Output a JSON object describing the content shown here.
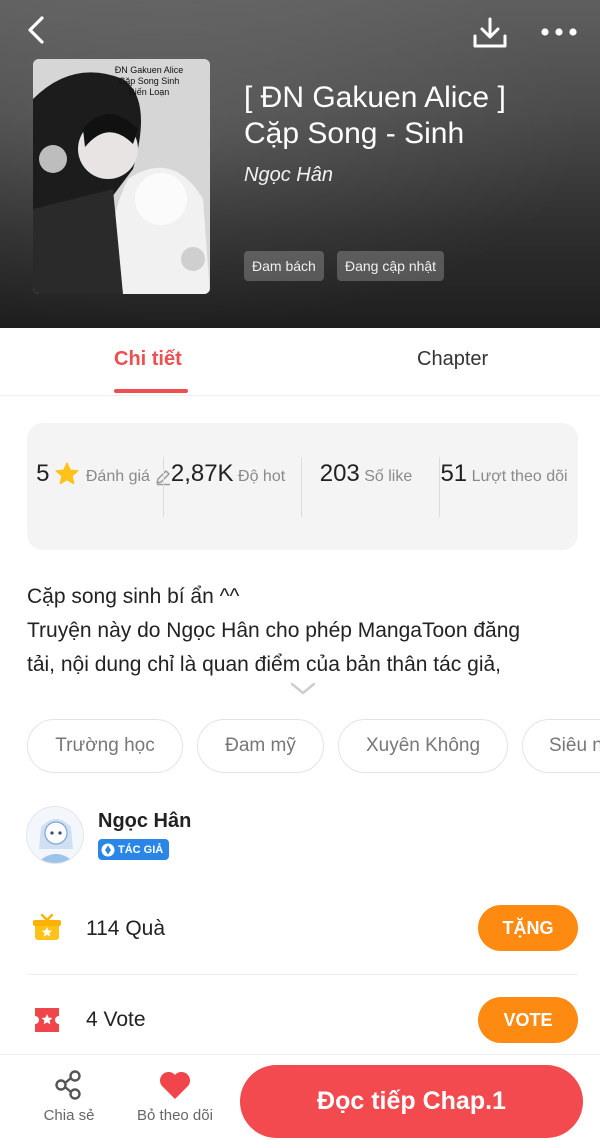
{
  "header": {
    "back_icon": "chevron-left-icon",
    "download_icon": "download-icon",
    "more_icon": "more-horizontal-icon",
    "cover": {
      "title_lines": [
        "ĐN Gakuen Alice",
        "Cặp Song Sinh",
        "Biến Loạn"
      ]
    },
    "title_line1": "[ ĐN Gakuen Alice ]",
    "title_line2": "Cặp Song - Sinh",
    "author": "Ngọc Hân",
    "tags": [
      "Đam bách",
      "Đang cập nhật"
    ]
  },
  "tabs": [
    {
      "label": "Chi tiết",
      "active": true
    },
    {
      "label": "Chapter",
      "active": false
    }
  ],
  "stats": [
    {
      "value": "5",
      "label": "Đánh giá",
      "value_icon": "star-icon",
      "label_icon": "pencil-icon"
    },
    {
      "value": "2,87K",
      "label": "Độ hot"
    },
    {
      "value": "203",
      "label": "Số like"
    },
    {
      "value": "51",
      "label": "Lượt theo dõi"
    }
  ],
  "description": {
    "line1": "Cặp song sinh bí ẩn ^^",
    "line2": "Truyện này do Ngọc Hân cho phép MangaToon đăng",
    "line3": "tải, nội dung chỉ là quan điểm của bản thân tác giả,"
  },
  "genres": [
    "Trường học",
    "Đam mỹ",
    "Xuyên Không",
    "Siêu n"
  ],
  "author_section": {
    "name": "Ngọc Hân",
    "badge": "TÁC GIẢ"
  },
  "gift_row": {
    "text": "114 Quà",
    "button": "TẶNG",
    "icon": "gift-icon"
  },
  "vote_row": {
    "text": "4 Vote",
    "button": "VOTE",
    "icon": "ticket-icon"
  },
  "bottom_bar": {
    "share_label": "Chia sẻ",
    "unfollow_label": "Bỏ theo dõi",
    "read_button": "Đọc tiếp Chap.1"
  },
  "colors": {
    "accent": "#f04e50",
    "orange": "#ff8a12",
    "gold": "#ffc21a",
    "badge_blue": "#2a86e6"
  }
}
